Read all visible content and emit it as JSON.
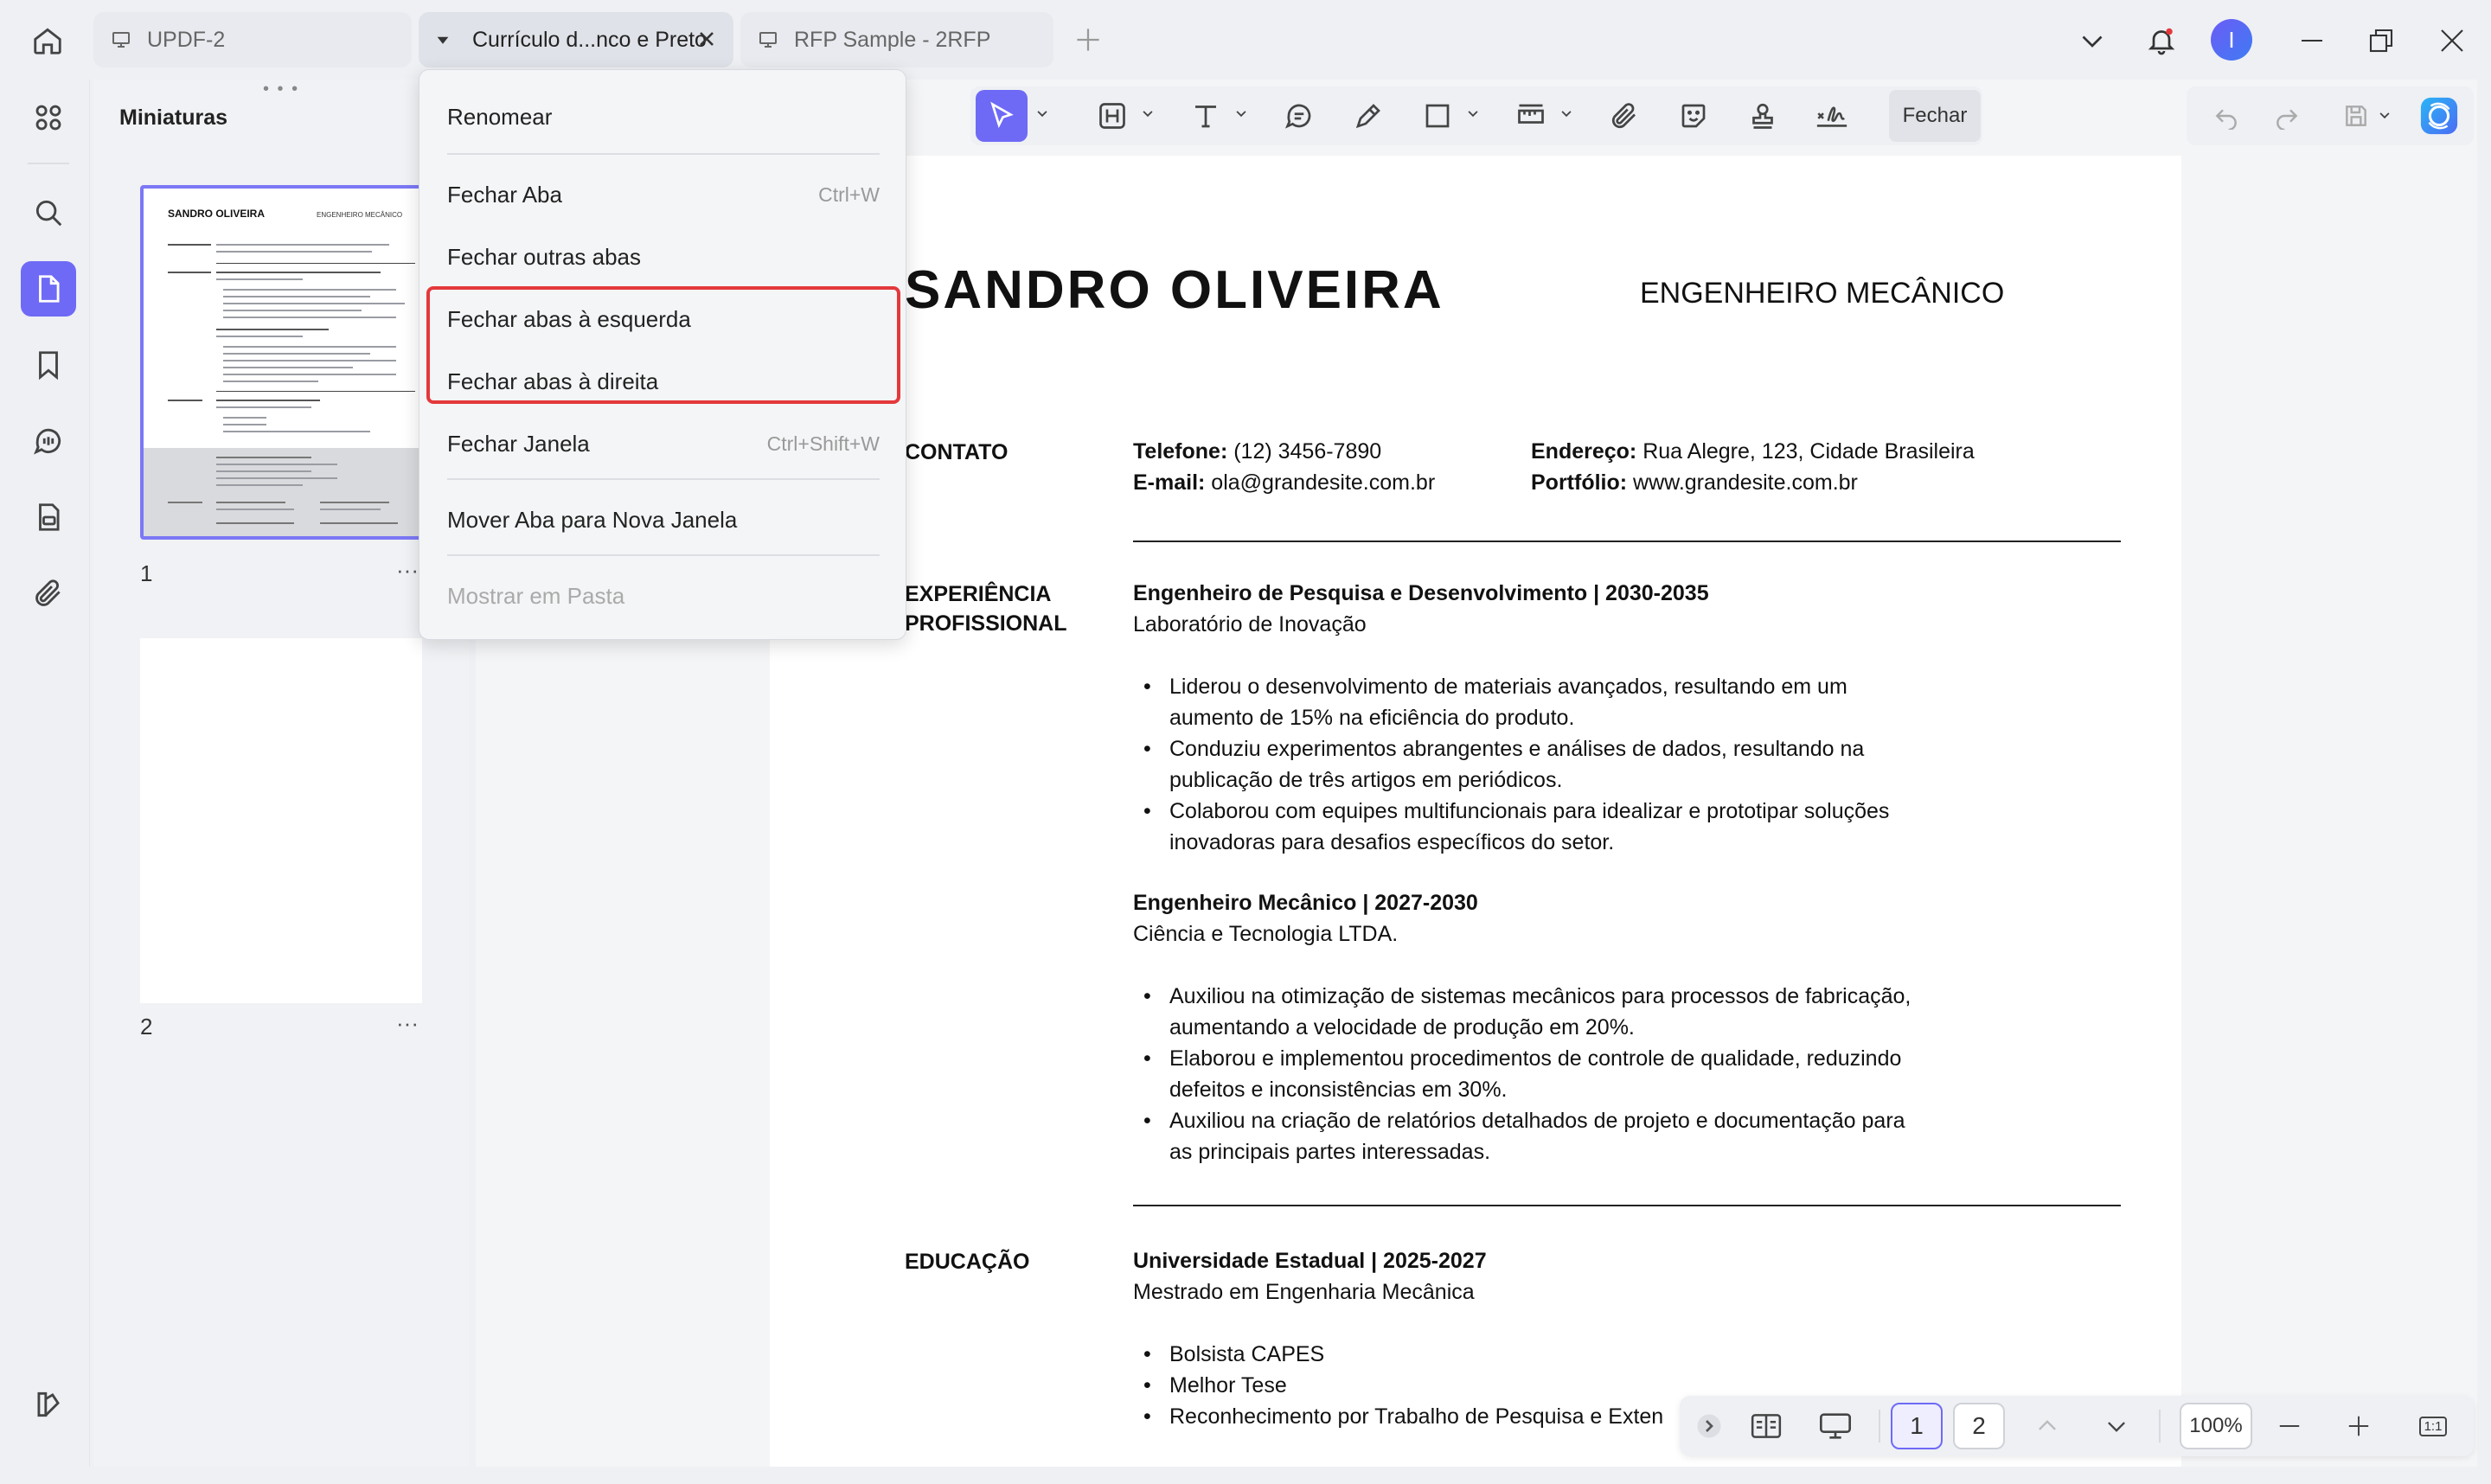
{
  "tabs": [
    {
      "label": "UPDF-2"
    },
    {
      "label": "Currículo d...nco e Preto"
    },
    {
      "label": "RFP Sample - 2RFP"
    }
  ],
  "user": {
    "avatar_letter": "I"
  },
  "thumbnails": {
    "title": "Miniaturas",
    "pages": [
      {
        "number": "1"
      },
      {
        "number": "2"
      }
    ],
    "more": "···"
  },
  "context_menu": {
    "items": [
      {
        "label": "Renomear",
        "shortcut": ""
      },
      {
        "label": "Fechar Aba",
        "shortcut": "Ctrl+W"
      },
      {
        "label": "Fechar outras abas",
        "shortcut": ""
      },
      {
        "label": "Fechar abas à esquerda",
        "shortcut": ""
      },
      {
        "label": "Fechar abas à direita",
        "shortcut": ""
      },
      {
        "label": "Fechar Janela",
        "shortcut": "Ctrl+Shift+W"
      },
      {
        "label": "Mover Aba para Nova Janela",
        "shortcut": ""
      },
      {
        "label": "Mostrar em Pasta",
        "shortcut": ""
      }
    ]
  },
  "toolbar": {
    "close_label": "Fechar"
  },
  "document": {
    "name": "SANDRO OLIVEIRA",
    "role": "ENGENHEIRO MECÂNICO",
    "contact": {
      "heading": "CONTATO",
      "phone_label": "Telefone:",
      "phone": " (12) 3456-7890",
      "email_label": "E-mail:",
      "email": " ola@grandesite.com.br",
      "address_label": "Endereço:",
      "address": " Rua Alegre, 123, Cidade Brasileira",
      "portfolio_label": "Portfólio:",
      "portfolio": " www.grandesite.com.br"
    },
    "experience": {
      "heading_line1": "EXPERIÊNCIA",
      "heading_line2": "PROFISSIONAL",
      "jobs": [
        {
          "title": "Engenheiro de Pesquisa e Desenvolvimento | 2030-2035",
          "company": "Laboratório de Inovação",
          "bullets": [
            "Liderou o desenvolvimento de materiais avançados, resultando em um",
            "aumento de 15% na eficiência do produto.",
            "Conduziu experimentos abrangentes e análises de dados, resultando na",
            "publicação de três artigos em periódicos.",
            "Colaborou com equipes multifuncionais para idealizar e prototipar soluções",
            "inovadoras para desafios específicos do setor."
          ]
        },
        {
          "title": "Engenheiro Mecânico | 2027-2030",
          "company": "Ciência e Tecnologia LTDA.",
          "bullets": [
            "Auxiliou na otimização de sistemas mecânicos para processos de fabricação,",
            "aumentando a velocidade de produção em 20%.",
            "Elaborou e implementou procedimentos de controle de qualidade, reduzindo",
            "defeitos e inconsistências em 30%.",
            "Auxiliou na criação de relatórios detalhados de projeto e documentação para",
            "as principais partes interessadas."
          ]
        }
      ]
    },
    "education": {
      "heading": "EDUCAÇÃO",
      "school": "Universidade Estadual | 2025-2027",
      "degree": "Mestrado em Engenharia Mecânica",
      "bullets": [
        "Bolsista CAPES",
        "Melhor Tese",
        "Reconhecimento por Trabalho de Pesquisa e Exten"
      ]
    }
  },
  "pager": {
    "pages": [
      "1",
      "2"
    ],
    "zoom": "100%",
    "fit_label": "1:1"
  }
}
